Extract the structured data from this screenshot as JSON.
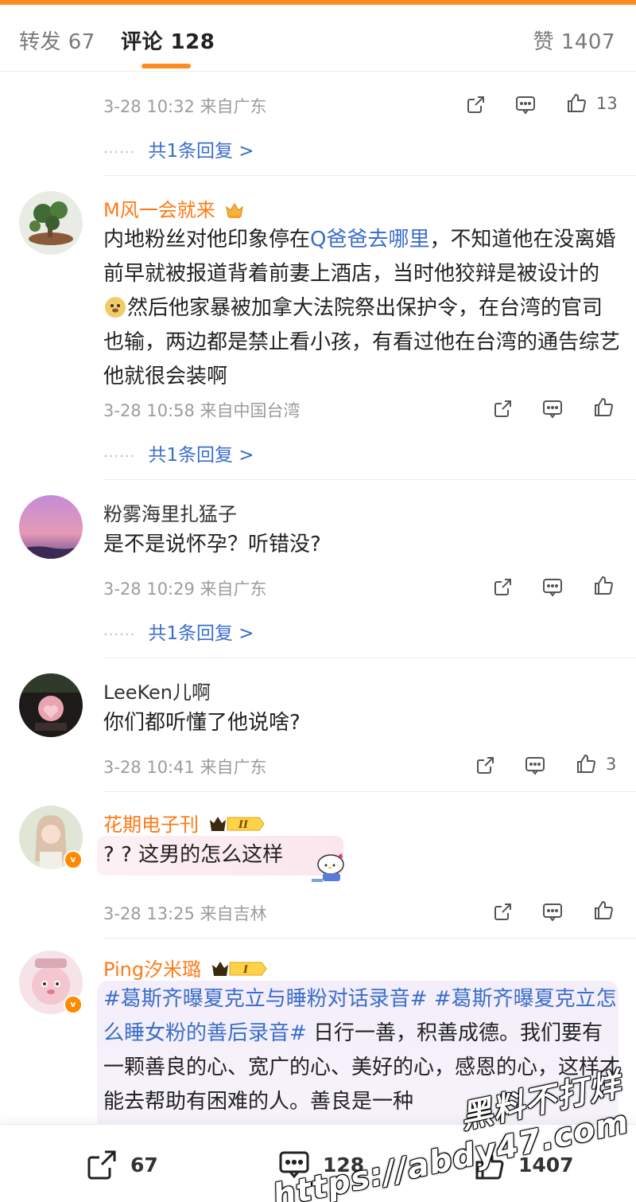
{
  "tabs": {
    "forward": "转发 67",
    "comments": "评论 128",
    "likes": "赞 1407"
  },
  "comments": [
    {
      "time": "3-28 10:32",
      "location": "来自广东",
      "likes": "13",
      "replies": "共1条回复 >"
    },
    {
      "user": "M风一会就来",
      "text_a": "内地粉丝对他印象停在",
      "topic": "Q爸爸去哪里",
      "text_b": "，不知道他在没离婚前早就被报道背着前妻上酒店，当时他狡辩是被设计的",
      "text_c": "然后他家暴被加拿大法院祭出保护令，在台湾的官司也输，两边都是禁止看小孩，有看过他在台湾的通告综艺他就很会装啊",
      "time": "3-28 10:58",
      "location": "来自中国台湾",
      "replies": "共1条回复 >"
    },
    {
      "user": "粉雾海里扎猛子",
      "text": "是不是说怀孕？听错没?",
      "time": "3-28 10:29",
      "location": "来自广东",
      "replies": "共1条回复 >"
    },
    {
      "user": "LeeKen儿啊",
      "text": "你们都听懂了他说啥?",
      "time": "3-28 10:41",
      "location": "来自广东",
      "likes": "3"
    },
    {
      "user": "花期电子刊",
      "badge_level": "II",
      "text": "? ?  这男的怎么这样",
      "time": "3-28 13:25",
      "location": "来自吉林"
    },
    {
      "user": "Ping汐米璐",
      "badge_level": "I",
      "topic": "#葛斯齐曝夏克立与睡粉对话录音# #葛斯齐曝夏克立怎么睡女粉的善后录音#",
      "text": " 日行一善，积善成德。我们要有一颗善良的心、宽广的心、美好的心，感恩的心，这样才能去帮助有困难的人。善良是一种"
    }
  ],
  "bottom_bar": {
    "forward_count": "67",
    "comment_count": "128",
    "like_count": "1407"
  },
  "watermark": {
    "line1": "黑料不打烊",
    "line2": "https://abdy47.com"
  },
  "colors": {
    "accent": "#ff8a1f",
    "link": "#3b6ecb",
    "username_highlight": "#ff7a14"
  }
}
